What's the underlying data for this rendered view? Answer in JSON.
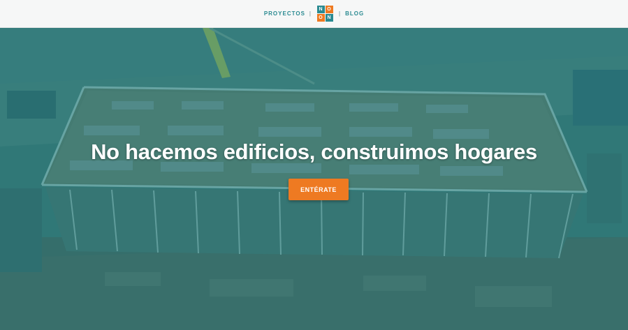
{
  "nav": {
    "left_link": "PROYECTOS",
    "separator": "|",
    "right_link": "BLOG",
    "logo_letters": [
      "N",
      "O",
      "O",
      "N"
    ],
    "logo_colors": [
      "#2a8a91",
      "#ee7a22",
      "#ee7a22",
      "#2a8a91"
    ]
  },
  "hero": {
    "headline": "No hacemos edificios, construimos hogares",
    "cta_label": "ENTÉRATE",
    "overlay_color": "#188088",
    "cta_color": "#ee7a22"
  }
}
